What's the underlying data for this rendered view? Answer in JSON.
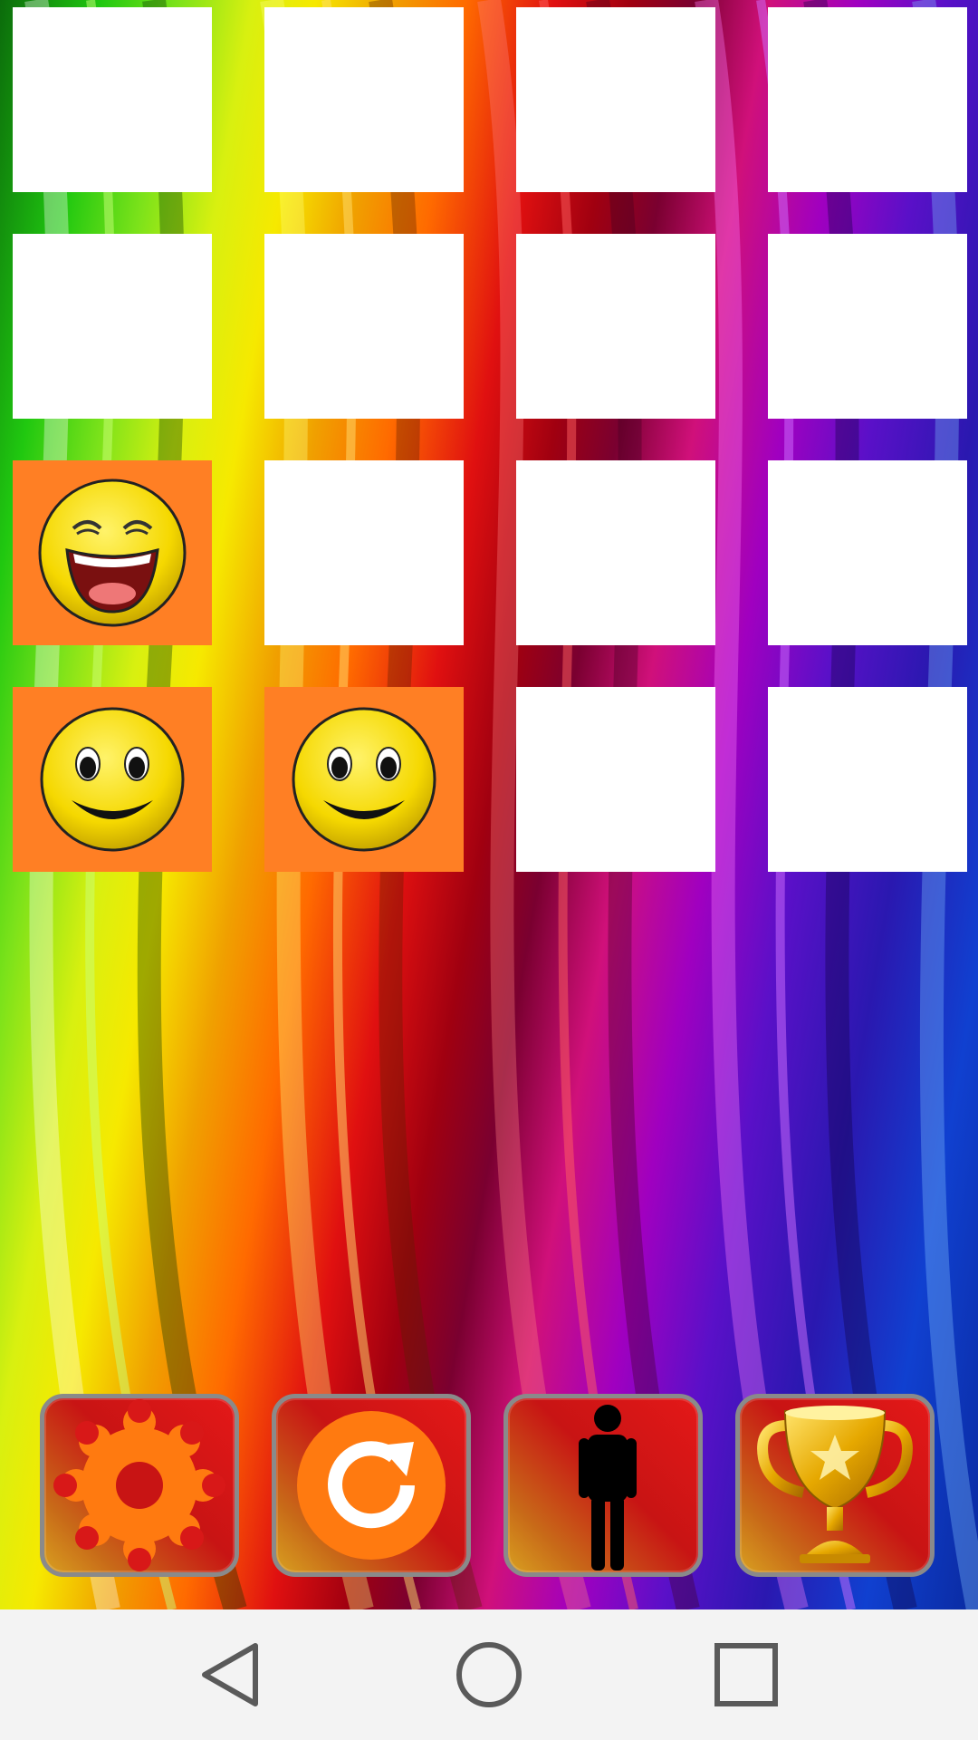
{
  "board": {
    "rows": 4,
    "cols": 4,
    "tiles": [
      {
        "state": "hidden"
      },
      {
        "state": "hidden"
      },
      {
        "state": "hidden"
      },
      {
        "state": "hidden"
      },
      {
        "state": "hidden"
      },
      {
        "state": "hidden"
      },
      {
        "state": "hidden"
      },
      {
        "state": "hidden"
      },
      {
        "state": "revealed",
        "icon": "laughing-face-icon"
      },
      {
        "state": "hidden"
      },
      {
        "state": "hidden"
      },
      {
        "state": "hidden"
      },
      {
        "state": "revealed",
        "icon": "smiling-face-icon"
      },
      {
        "state": "revealed",
        "icon": "smiling-face-icon"
      },
      {
        "state": "hidden"
      },
      {
        "state": "hidden"
      }
    ],
    "colors": {
      "hidden": "#ffffff",
      "revealed": "#ff7f24"
    }
  },
  "toolbar": {
    "buttons": [
      {
        "icon": "gear-icon"
      },
      {
        "icon": "restart-icon"
      },
      {
        "icon": "person-icon"
      },
      {
        "icon": "trophy-icon"
      }
    ]
  },
  "navbar": {
    "buttons": [
      {
        "icon": "back-triangle-icon"
      },
      {
        "icon": "home-circle-icon"
      },
      {
        "icon": "recents-square-icon"
      }
    ]
  }
}
